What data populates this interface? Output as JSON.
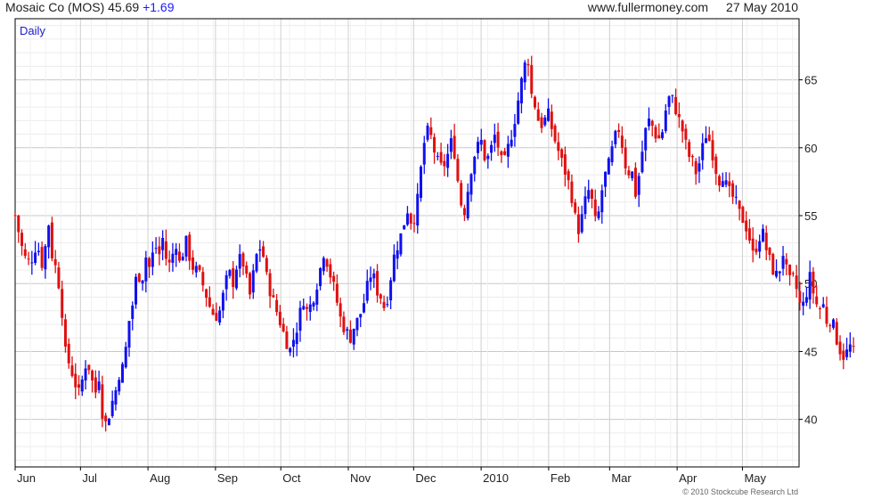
{
  "header": {
    "title": "Mosaic Co (MOS) 45.69",
    "change": "+1.69",
    "website": "www.fullermoney.com",
    "date": "27 May 2010"
  },
  "footer": {
    "copyright": "© 2010 Stockcube Research Ltd"
  },
  "chart_data": {
    "type": "ohlc",
    "period_label": "Daily",
    "ylim": [
      36.5,
      69.5
    ],
    "y_ticks": [
      40,
      45,
      50,
      55,
      60,
      65
    ],
    "y_axis_side": "right",
    "grid": true,
    "x_range_days": [
      0,
      360
    ],
    "month_ticks": [
      {
        "label": "Jun",
        "day": 0
      },
      {
        "label": "Jul",
        "day": 30
      },
      {
        "label": "Aug",
        "day": 61
      },
      {
        "label": "Sep",
        "day": 92
      },
      {
        "label": "Oct",
        "day": 122
      },
      {
        "label": "Nov",
        "day": 153
      },
      {
        "label": "Dec",
        "day": 183
      },
      {
        "label": "2010",
        "day": 214
      },
      {
        "label": "Feb",
        "day": 245
      },
      {
        "label": "Mar",
        "day": 273
      },
      {
        "label": "Apr",
        "day": 304
      },
      {
        "label": "May",
        "day": 334
      }
    ],
    "colors": {
      "up": "#1010ee",
      "down": "#e01010",
      "grid": "#d8d8d8",
      "axis": "#000000"
    },
    "path": [
      [
        0,
        55
      ],
      [
        4,
        52
      ],
      [
        7,
        51.5
      ],
      [
        10,
        53
      ],
      [
        13,
        51
      ],
      [
        15,
        55
      ],
      [
        17,
        52
      ],
      [
        19,
        51
      ],
      [
        21,
        49
      ],
      [
        22,
        47
      ],
      [
        23,
        45
      ],
      [
        25,
        44
      ],
      [
        27,
        43
      ],
      [
        29,
        41.8
      ],
      [
        31,
        43
      ],
      [
        33,
        44.5
      ],
      [
        35,
        43
      ],
      [
        37,
        42
      ],
      [
        39,
        43.5
      ],
      [
        40,
        40.5
      ],
      [
        42,
        39.5
      ],
      [
        44,
        41
      ],
      [
        46,
        42
      ],
      [
        48,
        43.5
      ],
      [
        50,
        44
      ],
      [
        52,
        47
      ],
      [
        54,
        48.5
      ],
      [
        56,
        51
      ],
      [
        58,
        50
      ],
      [
        60,
        52
      ],
      [
        62,
        51
      ],
      [
        64,
        53
      ],
      [
        66,
        52
      ],
      [
        68,
        53.5
      ],
      [
        70,
        51
      ],
      [
        72,
        52
      ],
      [
        74,
        53
      ],
      [
        76,
        51
      ],
      [
        78,
        53.5
      ],
      [
        80,
        52
      ],
      [
        82,
        51
      ],
      [
        84,
        51
      ],
      [
        86,
        50
      ],
      [
        88,
        49
      ],
      [
        90,
        48
      ],
      [
        92,
        47.5
      ],
      [
        94,
        48
      ],
      [
        96,
        49.5
      ],
      [
        98,
        51
      ],
      [
        100,
        50
      ],
      [
        102,
        51.5
      ],
      [
        104,
        52
      ],
      [
        106,
        50.5
      ],
      [
        108,
        49
      ],
      [
        110,
        51.5
      ],
      [
        112,
        52.8
      ],
      [
        114,
        52
      ],
      [
        116,
        50
      ],
      [
        118,
        49
      ],
      [
        120,
        48
      ],
      [
        122,
        47
      ],
      [
        124,
        46
      ],
      [
        126,
        45
      ],
      [
        128,
        46
      ],
      [
        130,
        47
      ],
      [
        132,
        49
      ],
      [
        134,
        48
      ],
      [
        136,
        48.5
      ],
      [
        138,
        49.5
      ],
      [
        140,
        51
      ],
      [
        142,
        52.5
      ],
      [
        144,
        51
      ],
      [
        146,
        50
      ],
      [
        148,
        48.5
      ],
      [
        150,
        47
      ],
      [
        152,
        46.5
      ],
      [
        154,
        46
      ],
      [
        156,
        47
      ],
      [
        158,
        47.5
      ],
      [
        160,
        48.5
      ],
      [
        162,
        50
      ],
      [
        164,
        51
      ],
      [
        166,
        49.5
      ],
      [
        168,
        49
      ],
      [
        170,
        48
      ],
      [
        172,
        50
      ],
      [
        174,
        52
      ],
      [
        176,
        53
      ],
      [
        178,
        54
      ],
      [
        180,
        55.5
      ],
      [
        182,
        54.5
      ],
      [
        184,
        55
      ],
      [
        186,
        58
      ],
      [
        188,
        60.5
      ],
      [
        190,
        61.5
      ],
      [
        192,
        60
      ],
      [
        194,
        59
      ],
      [
        196,
        58.5
      ],
      [
        198,
        59
      ],
      [
        200,
        60.5
      ],
      [
        202,
        59.5
      ],
      [
        204,
        56.5
      ],
      [
        206,
        55
      ],
      [
        208,
        57
      ],
      [
        210,
        59
      ],
      [
        212,
        60
      ],
      [
        214,
        60.5
      ],
      [
        216,
        59
      ],
      [
        218,
        59.5
      ],
      [
        220,
        61
      ],
      [
        222,
        60
      ],
      [
        224,
        58.5
      ],
      [
        226,
        59.8
      ],
      [
        228,
        61
      ],
      [
        230,
        62.5
      ],
      [
        232,
        64.5
      ],
      [
        234,
        66
      ],
      [
        235,
        67.5
      ],
      [
        237,
        64
      ],
      [
        239,
        63
      ],
      [
        241,
        61.5
      ],
      [
        243,
        62
      ],
      [
        245,
        62.5
      ],
      [
        247,
        61
      ],
      [
        249,
        60
      ],
      [
        251,
        59
      ],
      [
        253,
        58
      ],
      [
        255,
        57
      ],
      [
        257,
        55
      ],
      [
        259,
        53.8
      ],
      [
        261,
        55.5
      ],
      [
        263,
        57
      ],
      [
        265,
        56
      ],
      [
        267,
        54
      ],
      [
        269,
        56.5
      ],
      [
        271,
        58
      ],
      [
        273,
        59
      ],
      [
        275,
        60.5
      ],
      [
        277,
        61.5
      ],
      [
        279,
        60
      ],
      [
        281,
        58
      ],
      [
        283,
        58.5
      ],
      [
        285,
        56.5
      ],
      [
        287,
        58.5
      ],
      [
        289,
        61
      ],
      [
        291,
        62
      ],
      [
        293,
        61.5
      ],
      [
        295,
        60.5
      ],
      [
        297,
        61
      ],
      [
        299,
        63
      ],
      [
        301,
        64
      ],
      [
        303,
        63
      ],
      [
        305,
        62
      ],
      [
        307,
        61
      ],
      [
        309,
        59.5
      ],
      [
        311,
        59
      ],
      [
        313,
        58
      ],
      [
        315,
        59.5
      ],
      [
        317,
        61
      ],
      [
        319,
        60.5
      ],
      [
        321,
        59
      ],
      [
        323,
        57.5
      ],
      [
        325,
        58
      ],
      [
        327,
        57
      ],
      [
        329,
        56.5
      ],
      [
        331,
        56
      ],
      [
        333,
        55
      ],
      [
        335,
        54.5
      ],
      [
        337,
        53.5
      ],
      [
        339,
        52
      ],
      [
        341,
        53
      ],
      [
        343,
        54
      ],
      [
        345,
        52.5
      ],
      [
        347,
        51.5
      ],
      [
        349,
        50.5
      ],
      [
        351,
        51
      ],
      [
        353,
        52.5
      ],
      [
        355,
        50
      ],
      [
        357,
        50.5
      ],
      [
        359,
        49.5
      ],
      [
        361,
        48
      ],
      [
        363,
        49
      ],
      [
        365,
        50.5
      ],
      [
        367,
        49
      ],
      [
        369,
        48
      ],
      [
        371,
        48.5
      ],
      [
        373,
        47
      ],
      [
        375,
        47.5
      ],
      [
        377,
        46
      ],
      [
        379,
        45
      ],
      [
        381,
        44.5
      ],
      [
        383,
        45.5
      ],
      [
        385,
        45
      ]
    ]
  }
}
